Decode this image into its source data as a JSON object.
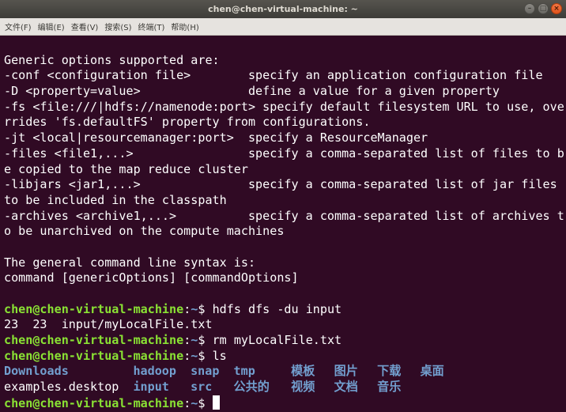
{
  "window": {
    "title": "chen@chen-virtual-machine: ~"
  },
  "menu": [
    "文件(F)",
    "编辑(E)",
    "查看(V)",
    "搜索(S)",
    "终端(T)",
    "帮助(H)"
  ],
  "colors": {
    "background": "#300a24",
    "prompt_user": "#8ae234",
    "prompt_path": "#729fcf",
    "directory": "#729fcf",
    "text": "#ffffff"
  },
  "prompt": {
    "user_host": "chen@chen-virtual-machine",
    "colon": ":",
    "path": "~",
    "symbol": "$ "
  },
  "output_lines": [
    "",
    "Generic options supported are:",
    "-conf <configuration file>        specify an application configuration file",
    "-D <property=value>               define a value for a given property",
    "-fs <file:///|hdfs://namenode:port> specify default filesystem URL to use, ove",
    "rrides 'fs.defaultFS' property from configurations.",
    "-jt <local|resourcemanager:port>  specify a ResourceManager",
    "-files <file1,...>                specify a comma-separated list of files to b",
    "e copied to the map reduce cluster",
    "-libjars <jar1,...>               specify a comma-separated list of jar files",
    "to be included in the classpath",
    "-archives <archive1,...>          specify a comma-separated list of archives t",
    "o be unarchived on the compute machines",
    "",
    "The general command line syntax is:",
    "command [genericOptions] [commandOptions]",
    ""
  ],
  "commands": [
    {
      "command": "hdfs dfs -du input",
      "output": "23  23  input/myLocalFile.txt"
    },
    {
      "command": "rm myLocalFile.txt",
      "output": null
    },
    {
      "command": "ls",
      "output": null
    }
  ],
  "ls_listing": {
    "row1": [
      {
        "name": "Downloads",
        "type": "dir"
      },
      {
        "name": "hadoop",
        "type": "dir"
      },
      {
        "name": "snap",
        "type": "dir"
      },
      {
        "name": "tmp",
        "type": "dir"
      },
      {
        "name": "模板",
        "type": "dir"
      },
      {
        "name": "图片",
        "type": "dir"
      },
      {
        "name": "下载",
        "type": "dir"
      },
      {
        "name": "桌面",
        "type": "dir"
      }
    ],
    "row2": [
      {
        "name": "examples.desktop",
        "type": "file"
      },
      {
        "name": "input",
        "type": "dir"
      },
      {
        "name": "src",
        "type": "dir"
      },
      {
        "name": "公共的",
        "type": "dir"
      },
      {
        "name": "视频",
        "type": "dir"
      },
      {
        "name": "文档",
        "type": "dir"
      },
      {
        "name": "音乐",
        "type": "dir"
      }
    ]
  },
  "icons": {
    "minimize": "minimize-icon",
    "maximize": "maximize-icon",
    "close": "close-icon"
  }
}
